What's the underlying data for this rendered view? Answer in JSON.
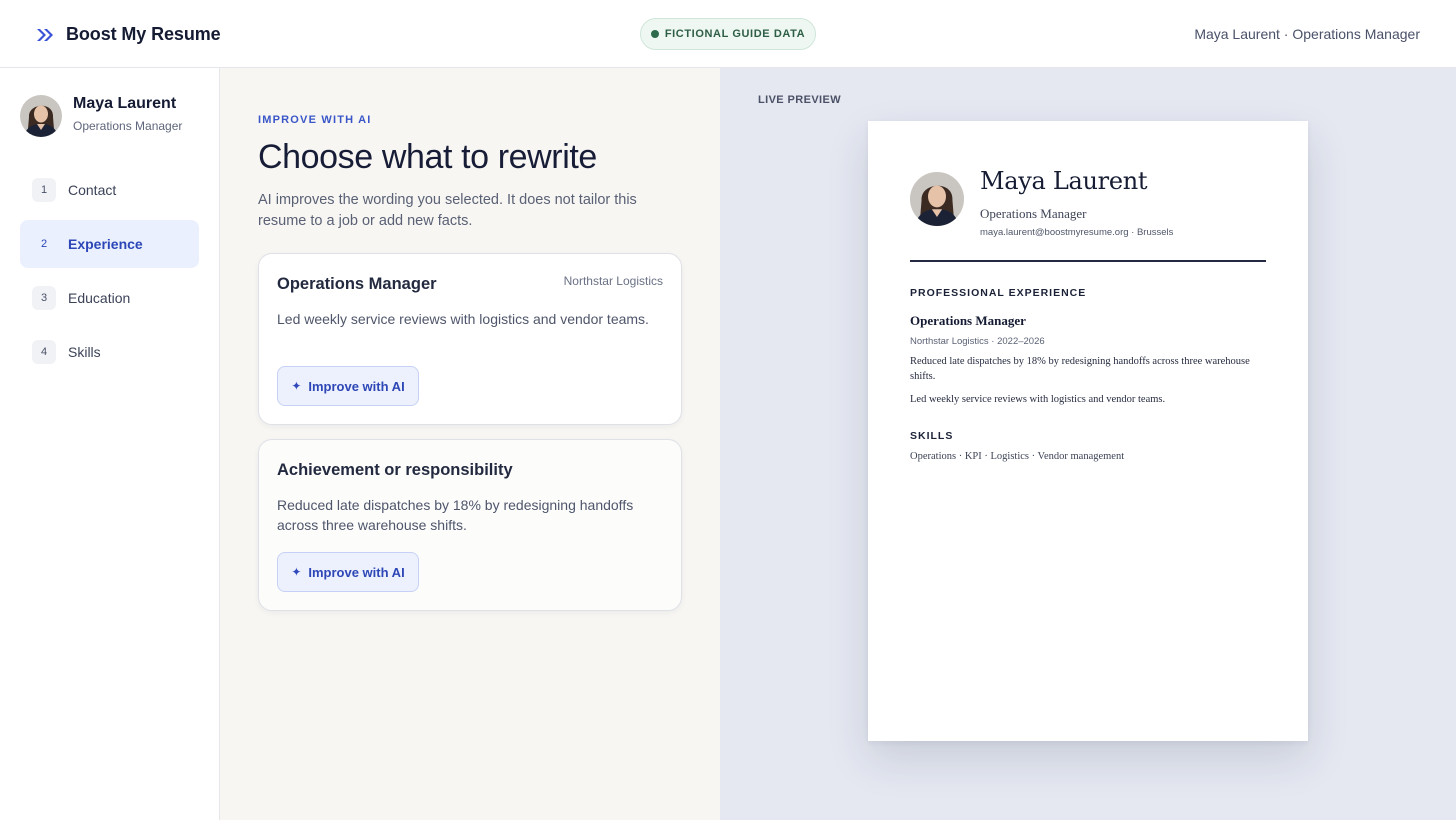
{
  "header": {
    "brand_name": "Boost My Resume",
    "brand_icon": "double-chevron-right-icon",
    "guide_pill": "FICTIONAL GUIDE DATA",
    "user_summary": "Maya Laurent · Operations Manager"
  },
  "sidebar": {
    "profile": {
      "name": "Maya Laurent",
      "role": "Operations Manager"
    },
    "steps": [
      {
        "num": "1",
        "label": "Contact",
        "active": false
      },
      {
        "num": "2",
        "label": "Experience",
        "active": true
      },
      {
        "num": "3",
        "label": "Education",
        "active": false
      },
      {
        "num": "4",
        "label": "Skills",
        "active": false
      }
    ]
  },
  "main": {
    "eyebrow": "IMPROVE WITH AI",
    "title": "Choose what to rewrite",
    "description": "AI improves the wording you selected. It does not tailor this resume to a job or add new facts.",
    "cards": [
      {
        "title": "Operations Manager",
        "company": "Northstar Logistics",
        "text": "Led weekly service reviews with logistics and vendor teams.",
        "button": "Improve with AI"
      },
      {
        "title": "Achievement or responsibility",
        "company": "",
        "text": "Reduced late dispatches by 18% by redesigning handoffs across three warehouse shifts.",
        "button": "Improve with AI"
      }
    ],
    "button_icon": "sparkle-icon"
  },
  "preview": {
    "label": "LIVE PREVIEW",
    "resume": {
      "name": "Maya Laurent",
      "role": "Operations Manager",
      "contact": "maya.laurent@boostmyresume.org · Brussels",
      "experience_heading": "PROFESSIONAL EXPERIENCE",
      "job_title": "Operations Manager",
      "job_meta": "Northstar Logistics · 2022–2026",
      "bullets": [
        "Reduced late dispatches by 18% by redesigning handoffs across three warehouse shifts.",
        "Led weekly service reviews with logistics and vendor teams."
      ],
      "skills_heading": "SKILLS",
      "skills": "Operations · KPI · Logistics · Vendor management"
    }
  },
  "colors": {
    "accent": "#2c46b8",
    "accent_bg": "#eaf0fd",
    "guide_green": "#2e6a4c",
    "main_bg": "#f7f6f3",
    "preview_bg": "#e5e8f1"
  }
}
